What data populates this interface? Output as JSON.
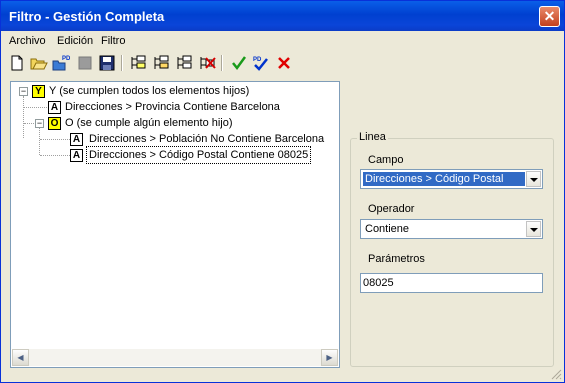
{
  "window": {
    "title": "Filtro - Gestión Completa",
    "close_glyph": "✕"
  },
  "menu": {
    "archivo": "Archivo",
    "edicion": "Edición",
    "filtro": "Filtro"
  },
  "toolbar": {
    "icons": [
      "new-file-icon",
      "open-folder-icon",
      "open-pd-icon",
      "disabled-icon",
      "save-icon",
      "add-y-node-icon",
      "add-o-node-icon",
      "add-a-node-icon",
      "delete-node-icon",
      "check-icon",
      "pd-check-icon",
      "cancel-icon"
    ]
  },
  "tree": {
    "root": {
      "badge": "Y",
      "label": "Y (se cumplen todos los elementos hijos)",
      "expander": "−"
    },
    "child1": {
      "badge": "A",
      "label": "Direcciones > Provincia Contiene Barcelona"
    },
    "child2": {
      "badge": "O",
      "label": "O (se cumple algún elemento hijo)",
      "expander": "−"
    },
    "child21": {
      "badge": "A",
      "label": "Direcciones > Población No Contiene Barcelona"
    },
    "child22": {
      "badge": "A",
      "label": "Direcciones > Código Postal Contiene 08025"
    }
  },
  "panel": {
    "legend": "Linea",
    "campo_label": "Campo",
    "campo_value": "Direcciones > Código Postal",
    "operador_label": "Operador",
    "operador_value": "Contiene",
    "parametros_label": "Parámetros",
    "parametros_value": "08025"
  },
  "scrollbar": {
    "left_glyph": "◀",
    "right_glyph": "▶"
  },
  "colors": {
    "title_bar": "#0040d0",
    "selection": "#316ac5",
    "y_badge": "#ffff00",
    "o_badge": "#ffff00"
  }
}
